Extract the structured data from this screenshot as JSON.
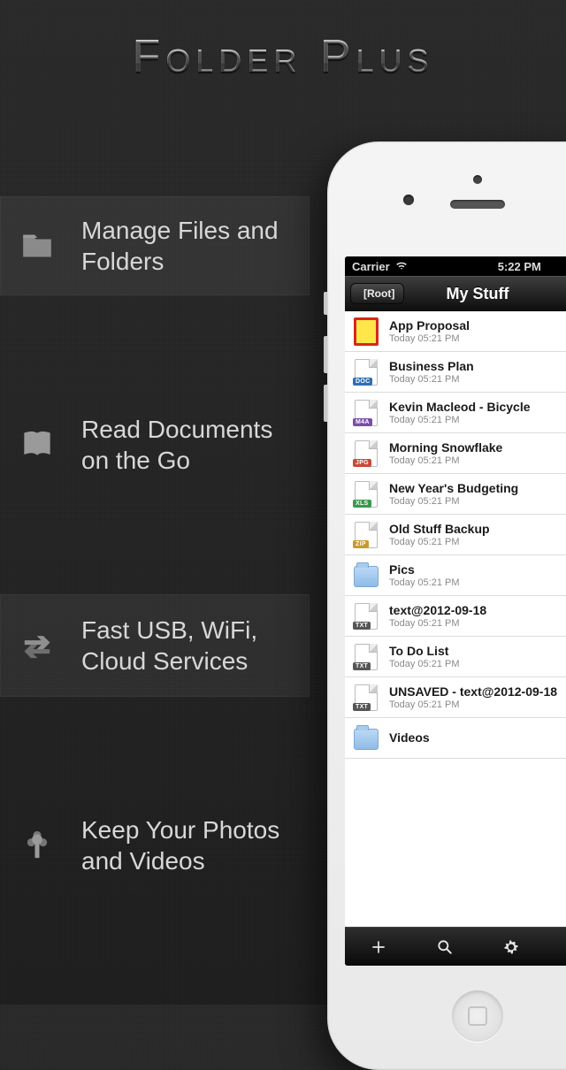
{
  "app_title": "Folder Plus",
  "features": [
    {
      "icon": "folder-icon",
      "label": "Manage Files and Folders",
      "highlight": true
    },
    {
      "icon": "book-icon",
      "label": "Read Documents on the Go",
      "highlight": false
    },
    {
      "icon": "transfer-icon",
      "label": "Fast USB, WiFi, Cloud Services",
      "highlight": true
    },
    {
      "icon": "flower-icon",
      "label": "Keep Your Photos and Videos",
      "highlight": false
    }
  ],
  "phone": {
    "status": {
      "carrier": "Carrier",
      "time": "5:22 PM"
    },
    "nav": {
      "back": "[Root]",
      "title": "My Stuff"
    },
    "files": [
      {
        "name": "App Proposal",
        "meta": "Today 05:21 PM",
        "type": "app"
      },
      {
        "name": "Business Plan",
        "meta": "Today 05:21 PM",
        "type": "doc",
        "badge_color": "#2e6fb3"
      },
      {
        "name": "Kevin Macleod - Bicycle",
        "meta": "Today 05:21 PM",
        "type": "m4a",
        "badge_color": "#7a4ea8"
      },
      {
        "name": "Morning Snowflake",
        "meta": "Today 05:21 PM",
        "type": "jpg",
        "badge_color": "#c84a3a"
      },
      {
        "name": "New Year's Budgeting",
        "meta": "Today 05:21 PM",
        "type": "xls",
        "badge_color": "#3a9a4a"
      },
      {
        "name": "Old Stuff Backup",
        "meta": "Today 05:21 PM",
        "type": "zip",
        "badge_color": "#c89a2a"
      },
      {
        "name": "Pics",
        "meta": "Today 05:21 PM",
        "type": "folder"
      },
      {
        "name": "text@2012-09-18",
        "meta": "Today 05:21 PM",
        "type": "txt",
        "badge_color": "#555"
      },
      {
        "name": "To Do List",
        "meta": "Today 05:21 PM",
        "type": "txt",
        "badge_color": "#555"
      },
      {
        "name": "UNSAVED - text@2012-09-18",
        "meta": "Today 05:21 PM",
        "type": "txt",
        "badge_color": "#555"
      },
      {
        "name": "Videos",
        "meta": "",
        "type": "folder"
      }
    ],
    "toolbar": {
      "add": "add-icon",
      "search": "search-icon",
      "settings": "gear-icon",
      "sort": "sort-az-icon"
    }
  }
}
